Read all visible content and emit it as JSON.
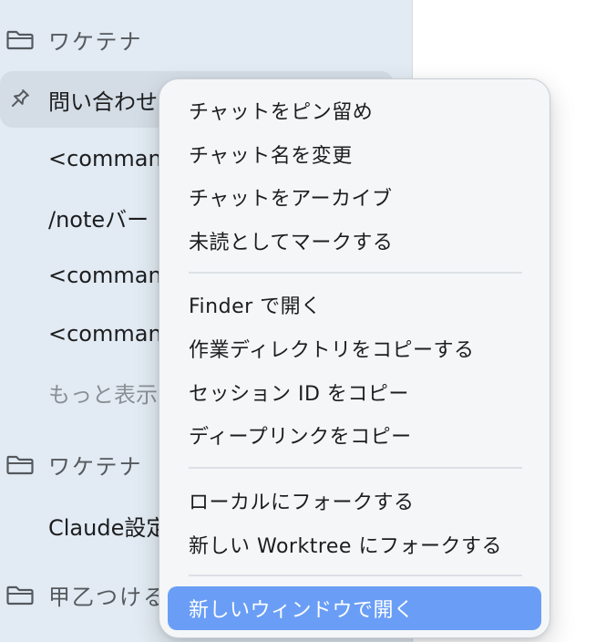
{
  "sidebar": {
    "folders": [
      {
        "label": "ワケテナ",
        "icon": "folder-icon"
      },
      {
        "label": "ワケテナ",
        "icon": "folder-icon"
      },
      {
        "label": "甲乙つける",
        "icon": "folder-icon"
      }
    ],
    "pinned_chat": {
      "label": "問い合わせ",
      "icon": "pin-icon"
    },
    "chats": [
      {
        "label": "<command"
      },
      {
        "label": "/noteバー"
      },
      {
        "label": "<command"
      },
      {
        "label": "<command"
      }
    ],
    "show_more": "もっと表示",
    "second_group_chats": [
      {
        "label": "Claude設定"
      }
    ]
  },
  "context_menu": {
    "groups": [
      [
        "チャットをピン留め",
        "チャット名を変更",
        "チャットをアーカイブ",
        "未読としてマークする"
      ],
      [
        "Finder で開く",
        "作業ディレクトリをコピーする",
        "セッション ID をコピー",
        "ディープリンクをコピー"
      ],
      [
        "ローカルにフォークする",
        "新しい Worktree にフォークする"
      ],
      [
        "新しいウィンドウで開く"
      ]
    ],
    "highlighted_item": "新しいウィンドウで開く",
    "highlight_color": "#6a9ef6"
  }
}
